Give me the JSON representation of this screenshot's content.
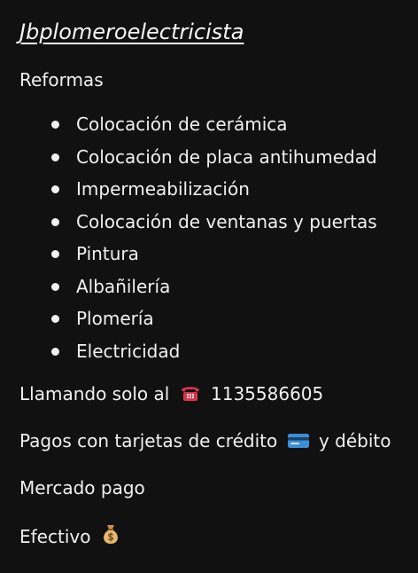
{
  "post": {
    "title": "Jbplomeroelectricista",
    "section_heading": "Reformas",
    "services": [
      "Colocación de cerámica",
      "Colocación de placa antihumedad",
      "Impermeabilización",
      "Colocación de ventanas y puertas",
      "Pintura",
      "Albañilería",
      "Plomería",
      "Electricidad"
    ],
    "call_prefix": "Llamando solo al",
    "phone": "1135586605",
    "payments_prefix": "Pagos con tarjetas de crédito",
    "payments_suffix": "y débito",
    "mercado_pago": "Mercado pago",
    "cash": "Efectivo"
  },
  "icons": {
    "phone": "telephone-emoji",
    "card": "credit-card-emoji",
    "cash": "money-bag-emoji"
  },
  "colors": {
    "background": "#111111",
    "text": "#f1f1f1",
    "phone_emoji": "#d9344b",
    "card_emoji": "#3b8fd6",
    "bag_emoji": "#e8b86a"
  }
}
